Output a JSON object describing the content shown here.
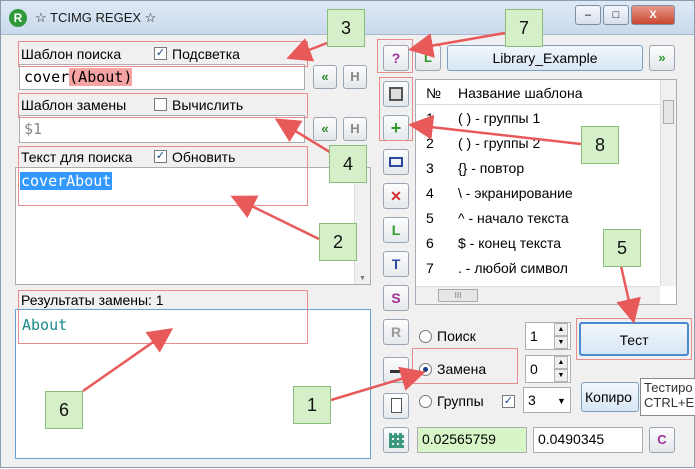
{
  "window": {
    "title": "☆ TCIMG REGEX ☆",
    "minimize": "–",
    "maximize": "□",
    "close": "X"
  },
  "search_pattern": {
    "label": "Шаблон поиска",
    "checkbox_label": "Подсветка",
    "checked": true,
    "value_plain": "cover",
    "value_group": "(About)"
  },
  "replace_pattern": {
    "label": "Шаблон замены",
    "checkbox_label": "Вычислить",
    "checked": false,
    "value": "$1"
  },
  "search_text": {
    "label": "Текст для поиска",
    "checkbox_label": "Обновить",
    "checked": true,
    "value": "coverAbout"
  },
  "results": {
    "label": "Результаты замены: 1",
    "value": "About"
  },
  "library": {
    "name": "Library_Example",
    "col_num": "№",
    "col_name": "Название шаблона",
    "rows": [
      {
        "n": "1",
        "name": "( ) - группы 1"
      },
      {
        "n": "2",
        "name": "( ) - группы 2"
      },
      {
        "n": "3",
        "name": "{} - повтор"
      },
      {
        "n": "4",
        "name": "\\ - экранирование"
      },
      {
        "n": "5",
        "name": "^ - начало текста"
      },
      {
        "n": "6",
        "name": "$ - конец текста"
      },
      {
        "n": "7",
        "name": ". - любой символ"
      }
    ],
    "hscroll_grip": "III"
  },
  "modes": {
    "search": "Поиск",
    "replace": "Замена",
    "groups": "Группы",
    "selected": "replace",
    "search_count": "1",
    "replace_count": "0",
    "groups_value": "3",
    "groups_checked": true
  },
  "buttons": {
    "test": "Тест",
    "copy": "Копиро",
    "help": "?",
    "h1": "H",
    "h2": "H",
    "back1": "«",
    "back2": "«",
    "lib_l": "L",
    "lib_next": "»",
    "add": "+",
    "remove": "✕",
    "tool_l": "L",
    "tool_t": "T",
    "tool_s": "S",
    "tool_r": "R",
    "tool_c": "C"
  },
  "tooltip": {
    "line1": "Тестиро",
    "line2": "CTRL+E"
  },
  "timings": {
    "t1": "0.02565759",
    "t2": "0.0490345"
  },
  "callouts": [
    "1",
    "2",
    "3",
    "4",
    "5",
    "6",
    "7",
    "8"
  ],
  "colors": {
    "selection": "#3399ff",
    "group_highlight": "#f5a3a3",
    "result_text": "#1a8a8a",
    "callout_fill": "#d5f0c8",
    "arrow": "#e85a5a",
    "timing_green": "#d8f5c8"
  }
}
